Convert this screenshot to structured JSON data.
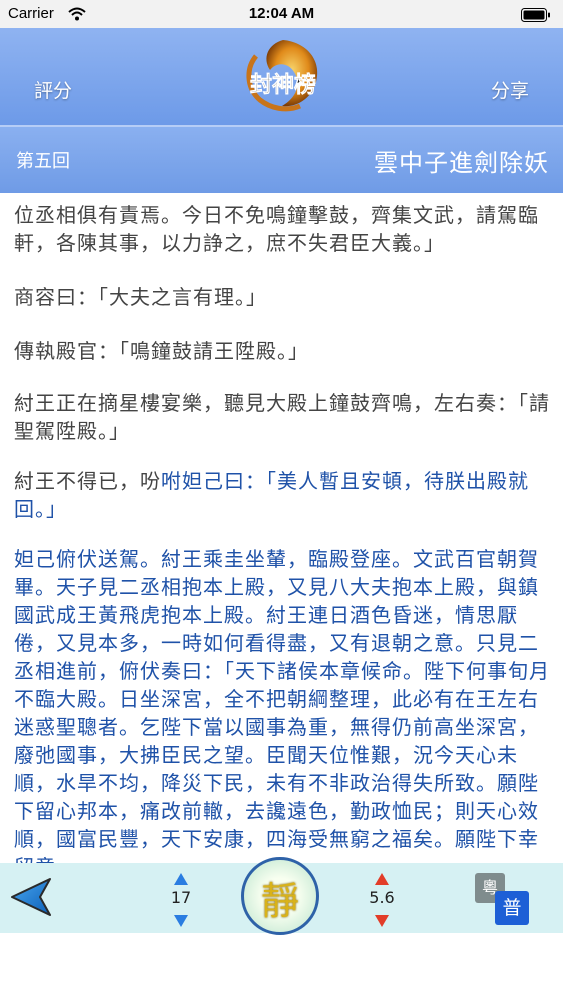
{
  "status": {
    "carrier": "Carrier",
    "time": "12:04 AM"
  },
  "header": {
    "rate_label": "評分",
    "share_label": "分享",
    "logo_text": "封神榜"
  },
  "chapter": {
    "number": "第五回",
    "title": "雲中子進劍除妖"
  },
  "content": {
    "p1": "位丞相俱有責焉。今日不免鳴鐘擊鼓，齊集文武，請駕臨軒，各陳其事，以力諍之，庶不失君臣大義。」",
    "p2": "商容曰：「大夫之言有理。」",
    "p3": "傳執殿官：「鳴鐘鼓請王陞殿。」",
    "p4": "紂王正在摘星樓宴樂，聽見大殿上鐘鼓齊鳴，左右奏：「請聖駕陞殿。」",
    "p5_gray": "紂王不得已，吩",
    "p5_blue": "咐妲己曰：「美人暫且安頓，待朕出殿就回。」",
    "p6": "妲己俯伏送駕。紂王乘圭坐輦，臨殿登座。文武百官朝賀畢。天子見二丞相抱本上殿，又見八大夫抱本上殿，與鎮國武成王黃飛虎抱本上殿。紂王連日酒色昏迷，情思厭倦，又見本多，一時如何看得盡，又有退朝之意。只見二丞相進前，俯伏奏曰：「天下諸侯本章候命。陛下何事旬月不臨大殿。日坐深宮，全不把朝綱整理，此必有在王左右迷惑聖聰者。乞陛下當以國事為重，無得仍前高坐深宮，廢弛國事，大拂臣民之望。臣聞天位惟艱，況今天心未順，水旱不均，降災下民，未有不非政治得失所致。願陛下留心邦本，痛改前轍，去讒遠色，勤政恤民；則天心效順，國富民豐，天下安康，四海受無窮之福矣。願陛下幸留意"
  },
  "toolbar": {
    "font_size_value": "17",
    "speed_value": "5.6",
    "quiet_label": "靜",
    "lang_cantonese": "粵",
    "lang_mandarin": "普"
  },
  "colors": {
    "header": "#7ea6ec",
    "toolbar": "#d6f1f3",
    "blue_text": "#1f52a8"
  }
}
